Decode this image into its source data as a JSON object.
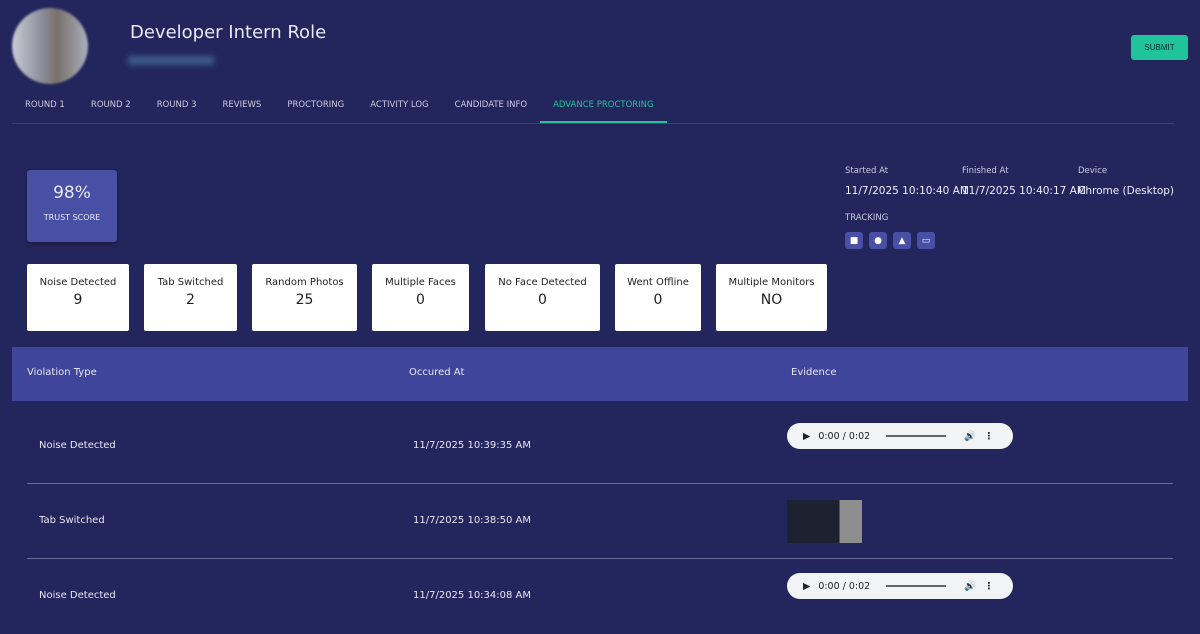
{
  "header": {
    "title": "Developer Intern Role",
    "submit_label": "SUBMIT"
  },
  "tabs": [
    {
      "label": "ROUND 1"
    },
    {
      "label": "ROUND 2"
    },
    {
      "label": "ROUND 3"
    },
    {
      "label": "REVIEWS"
    },
    {
      "label": "PROCTORING"
    },
    {
      "label": "ACTIVITY LOG"
    },
    {
      "label": "CANDIDATE INFO"
    },
    {
      "label": "ADVANCE PROCTORING",
      "active": true
    }
  ],
  "trust": {
    "value": "98%",
    "label": "TRUST SCORE"
  },
  "meta": {
    "started_label": "Started At",
    "started": "11/7/2025 10:10:40 AM",
    "finished_label": "Finished At",
    "finished": "11/7/2025 10:40:17 AM",
    "device_label": "Device",
    "device": "Chrome (Desktop)",
    "tracking_label": "TRACKING",
    "tracking_icons": [
      "video-icon",
      "mic-icon",
      "image-icon",
      "screen-share-icon"
    ]
  },
  "stats": [
    {
      "label": "Noise Detected",
      "value": "9"
    },
    {
      "label": "Tab Switched",
      "value": "2"
    },
    {
      "label": "Random Photos",
      "value": "25"
    },
    {
      "label": "Multiple Faces",
      "value": "0"
    },
    {
      "label": "No Face Detected",
      "value": "0"
    },
    {
      "label": "Went Offline",
      "value": "0"
    },
    {
      "label": "Multiple Monitors",
      "value": "NO"
    }
  ],
  "table": {
    "headers": [
      "Violation Type",
      "Occured At",
      "Evidence"
    ],
    "rows": [
      {
        "type": "Noise Detected",
        "time": "11/7/2025 10:39:35 AM",
        "audio": "0:00 / 0:02"
      },
      {
        "type": "Tab Switched",
        "time": "11/7/2025 10:38:50 AM"
      },
      {
        "type": "Noise Detected",
        "time": "11/7/2025 10:34:08 AM",
        "audio": "0:00 / 0:02"
      }
    ]
  },
  "colors": {
    "background": "#23265c",
    "accent": "#1fc49a",
    "header": "#40449a"
  }
}
